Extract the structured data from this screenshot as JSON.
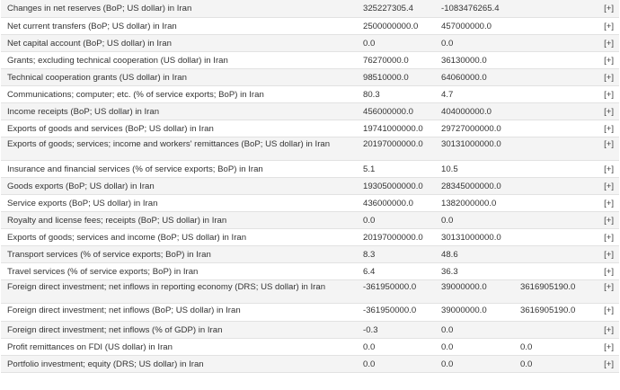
{
  "rows": [
    {
      "label": "Changes in net reserves (BoP; US dollar) in Iran",
      "v1": "325227305.4",
      "v2": "-1083476265.4",
      "v3": "",
      "action": "[+]"
    },
    {
      "label": "Net current transfers (BoP; US dollar) in Iran",
      "v1": "2500000000.0",
      "v2": "457000000.0",
      "v3": "",
      "action": "[+]"
    },
    {
      "label": "Net capital account (BoP; US dollar) in Iran",
      "v1": "0.0",
      "v2": "0.0",
      "v3": "",
      "action": "[+]"
    },
    {
      "label": "Grants; excluding technical cooperation (US dollar) in Iran",
      "v1": "76270000.0",
      "v2": "36130000.0",
      "v3": "",
      "action": "[+]"
    },
    {
      "label": "Technical cooperation grants (US dollar) in Iran",
      "v1": "98510000.0",
      "v2": "64060000.0",
      "v3": "",
      "action": "[+]"
    },
    {
      "label": "Communications; computer; etc. (% of service exports; BoP) in Iran",
      "v1": "80.3",
      "v2": "4.7",
      "v3": "",
      "action": "[+]"
    },
    {
      "label": "Income receipts (BoP; US dollar) in Iran",
      "v1": "456000000.0",
      "v2": "404000000.0",
      "v3": "",
      "action": "[+]"
    },
    {
      "label": "Exports of goods and services (BoP; US dollar) in Iran",
      "v1": "19741000000.0",
      "v2": "29727000000.0",
      "v3": "",
      "action": "[+]"
    },
    {
      "label": "Exports of goods; services; income and workers' remittances (BoP; US dollar) in Iran",
      "v1": "20197000000.0",
      "v2": "30131000000.0",
      "v3": "",
      "action": "[+]"
    },
    {
      "label": "Insurance and financial services (% of service exports; BoP) in Iran",
      "v1": "5.1",
      "v2": "10.5",
      "v3": "",
      "action": "[+]"
    },
    {
      "label": "Goods exports (BoP; US dollar) in Iran",
      "v1": "19305000000.0",
      "v2": "28345000000.0",
      "v3": "",
      "action": "[+]"
    },
    {
      "label": "Service exports (BoP; US dollar) in Iran",
      "v1": "436000000.0",
      "v2": "1382000000.0",
      "v3": "",
      "action": "[+]"
    },
    {
      "label": "Royalty and license fees; receipts (BoP; US dollar) in Iran",
      "v1": "0.0",
      "v2": "0.0",
      "v3": "",
      "action": "[+]"
    },
    {
      "label": "Exports of goods; services and income (BoP; US dollar) in Iran",
      "v1": "20197000000.0",
      "v2": "30131000000.0",
      "v3": "",
      "action": "[+]"
    },
    {
      "label": "Transport services (% of service exports; BoP) in Iran",
      "v1": "8.3",
      "v2": "48.6",
      "v3": "",
      "action": "[+]"
    },
    {
      "label": "Travel services (% of service exports; BoP) in Iran",
      "v1": "6.4",
      "v2": "36.3",
      "v3": "",
      "action": "[+]"
    },
    {
      "label": "Foreign direct investment; net inflows in reporting economy (DRS; US dollar) in Iran",
      "v1": "-361950000.0",
      "v2": "39000000.0",
      "v3": "3616905190.0",
      "action": "[+]"
    },
    {
      "label": "Foreign direct investment; net inflows (BoP; US dollar) in Iran",
      "v1": "-361950000.0",
      "v2": "39000000.0",
      "v3": "3616905190.0",
      "action": "[+]"
    },
    {
      "label": "Foreign direct investment; net inflows (% of GDP) in Iran",
      "v1": "-0.3",
      "v2": "0.0",
      "v3": "",
      "action": "[+]"
    },
    {
      "label": "Profit remittances on FDI (US dollar) in Iran",
      "v1": "0.0",
      "v2": "0.0",
      "v3": "0.0",
      "action": "[+]"
    },
    {
      "label": "Portfolio investment; equity (DRS; US dollar) in Iran",
      "v1": "0.0",
      "v2": "0.0",
      "v3": "0.0",
      "action": "[+]"
    }
  ]
}
